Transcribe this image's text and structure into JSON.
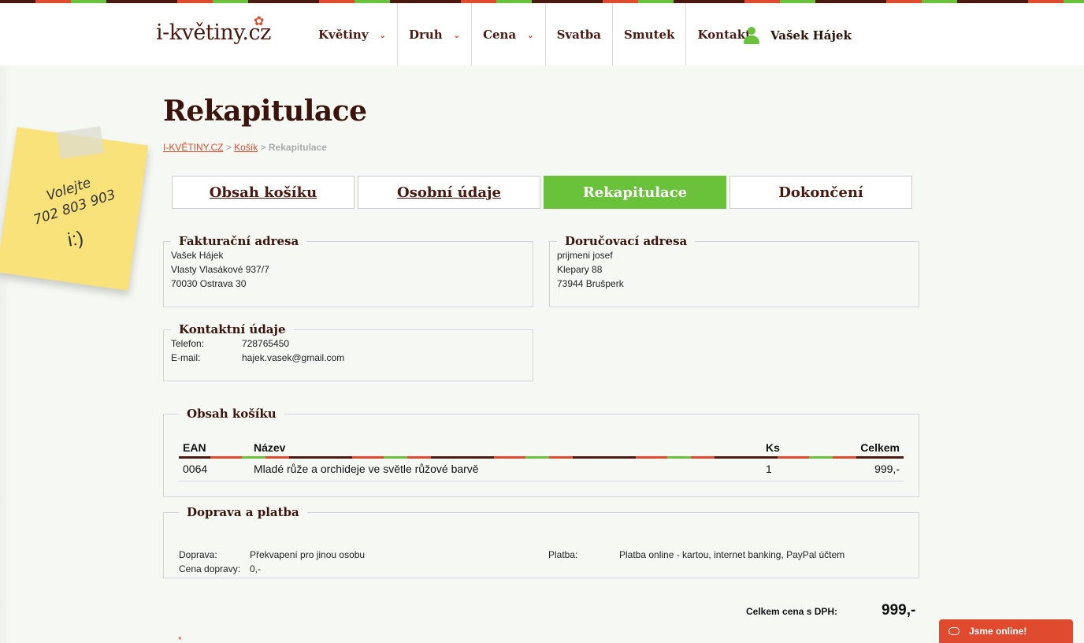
{
  "header": {
    "logo_text": "i-květiny.cz",
    "nav": [
      {
        "label": "Květiny",
        "has_dropdown": true
      },
      {
        "label": "Druh",
        "has_dropdown": true
      },
      {
        "label": "Cena",
        "has_dropdown": true
      },
      {
        "label": "Svatba",
        "has_dropdown": false
      },
      {
        "label": "Smutek",
        "has_dropdown": false
      },
      {
        "label": "Kontakt",
        "has_dropdown": false
      }
    ],
    "user_name": "Vašek Hájek",
    "user_icon": "user-icon"
  },
  "note": {
    "line1": "Volejte",
    "line2": "702 803 903",
    "smile": "i:)"
  },
  "page": {
    "title": "Rekapitulace",
    "breadcrumb": {
      "home": "I-KVĚTINY.CZ",
      "sep": ">",
      "cart": "Košík",
      "current": "Rekapitulace"
    }
  },
  "steps": [
    {
      "label": "Obsah košíku",
      "state": "link"
    },
    {
      "label": "Osobní údaje",
      "state": "link"
    },
    {
      "label": "Rekapitulace",
      "state": "active"
    },
    {
      "label": "Dokončení",
      "state": "inactive"
    }
  ],
  "billing": {
    "legend": "Fakturační adresa",
    "lines": [
      "Vašek Hájek",
      "Vlasty Vlasákové 937/7",
      "70030 Ostrava 30"
    ]
  },
  "delivery": {
    "legend": "Doručovací adresa",
    "lines": [
      "prijmeni josef",
      "Klepary 88",
      "73944 Brušperk"
    ]
  },
  "contact": {
    "legend": "Kontaktní údaje",
    "phone_label": "Telefon:",
    "phone": "728765450",
    "email_label": "E-mail:",
    "email": "hajek.vasek@gmail.com"
  },
  "cart": {
    "legend": "Obsah košíku",
    "columns": {
      "ean": "EAN",
      "name": "Název",
      "qty": "Ks",
      "total": "Celkem"
    },
    "rows": [
      {
        "ean": "0064",
        "name": "Mladé růže a orchideje ve světle růžové barvě",
        "qty": "1",
        "total": "999,-"
      }
    ]
  },
  "shipping": {
    "legend": "Doprava a platba",
    "transport_label": "Doprava:",
    "transport": "Překvapení pro jinou osobu",
    "price_label": "Cena dopravy:",
    "price": "0,-",
    "payment_label": "Platba:",
    "payment": "Platba online - kartou, internet banking, PayPal účtem"
  },
  "summary": {
    "total_label": "Celkem cena s DPH:",
    "total_value": "999,-",
    "required_mark": "*"
  },
  "chat": {
    "label": "Jsme online!",
    "icon": "chat-bubble-icon"
  },
  "colors": {
    "brand_red": "#e04a2e",
    "brand_green": "#6ac23a",
    "brand_brown": "#4a1a10"
  }
}
